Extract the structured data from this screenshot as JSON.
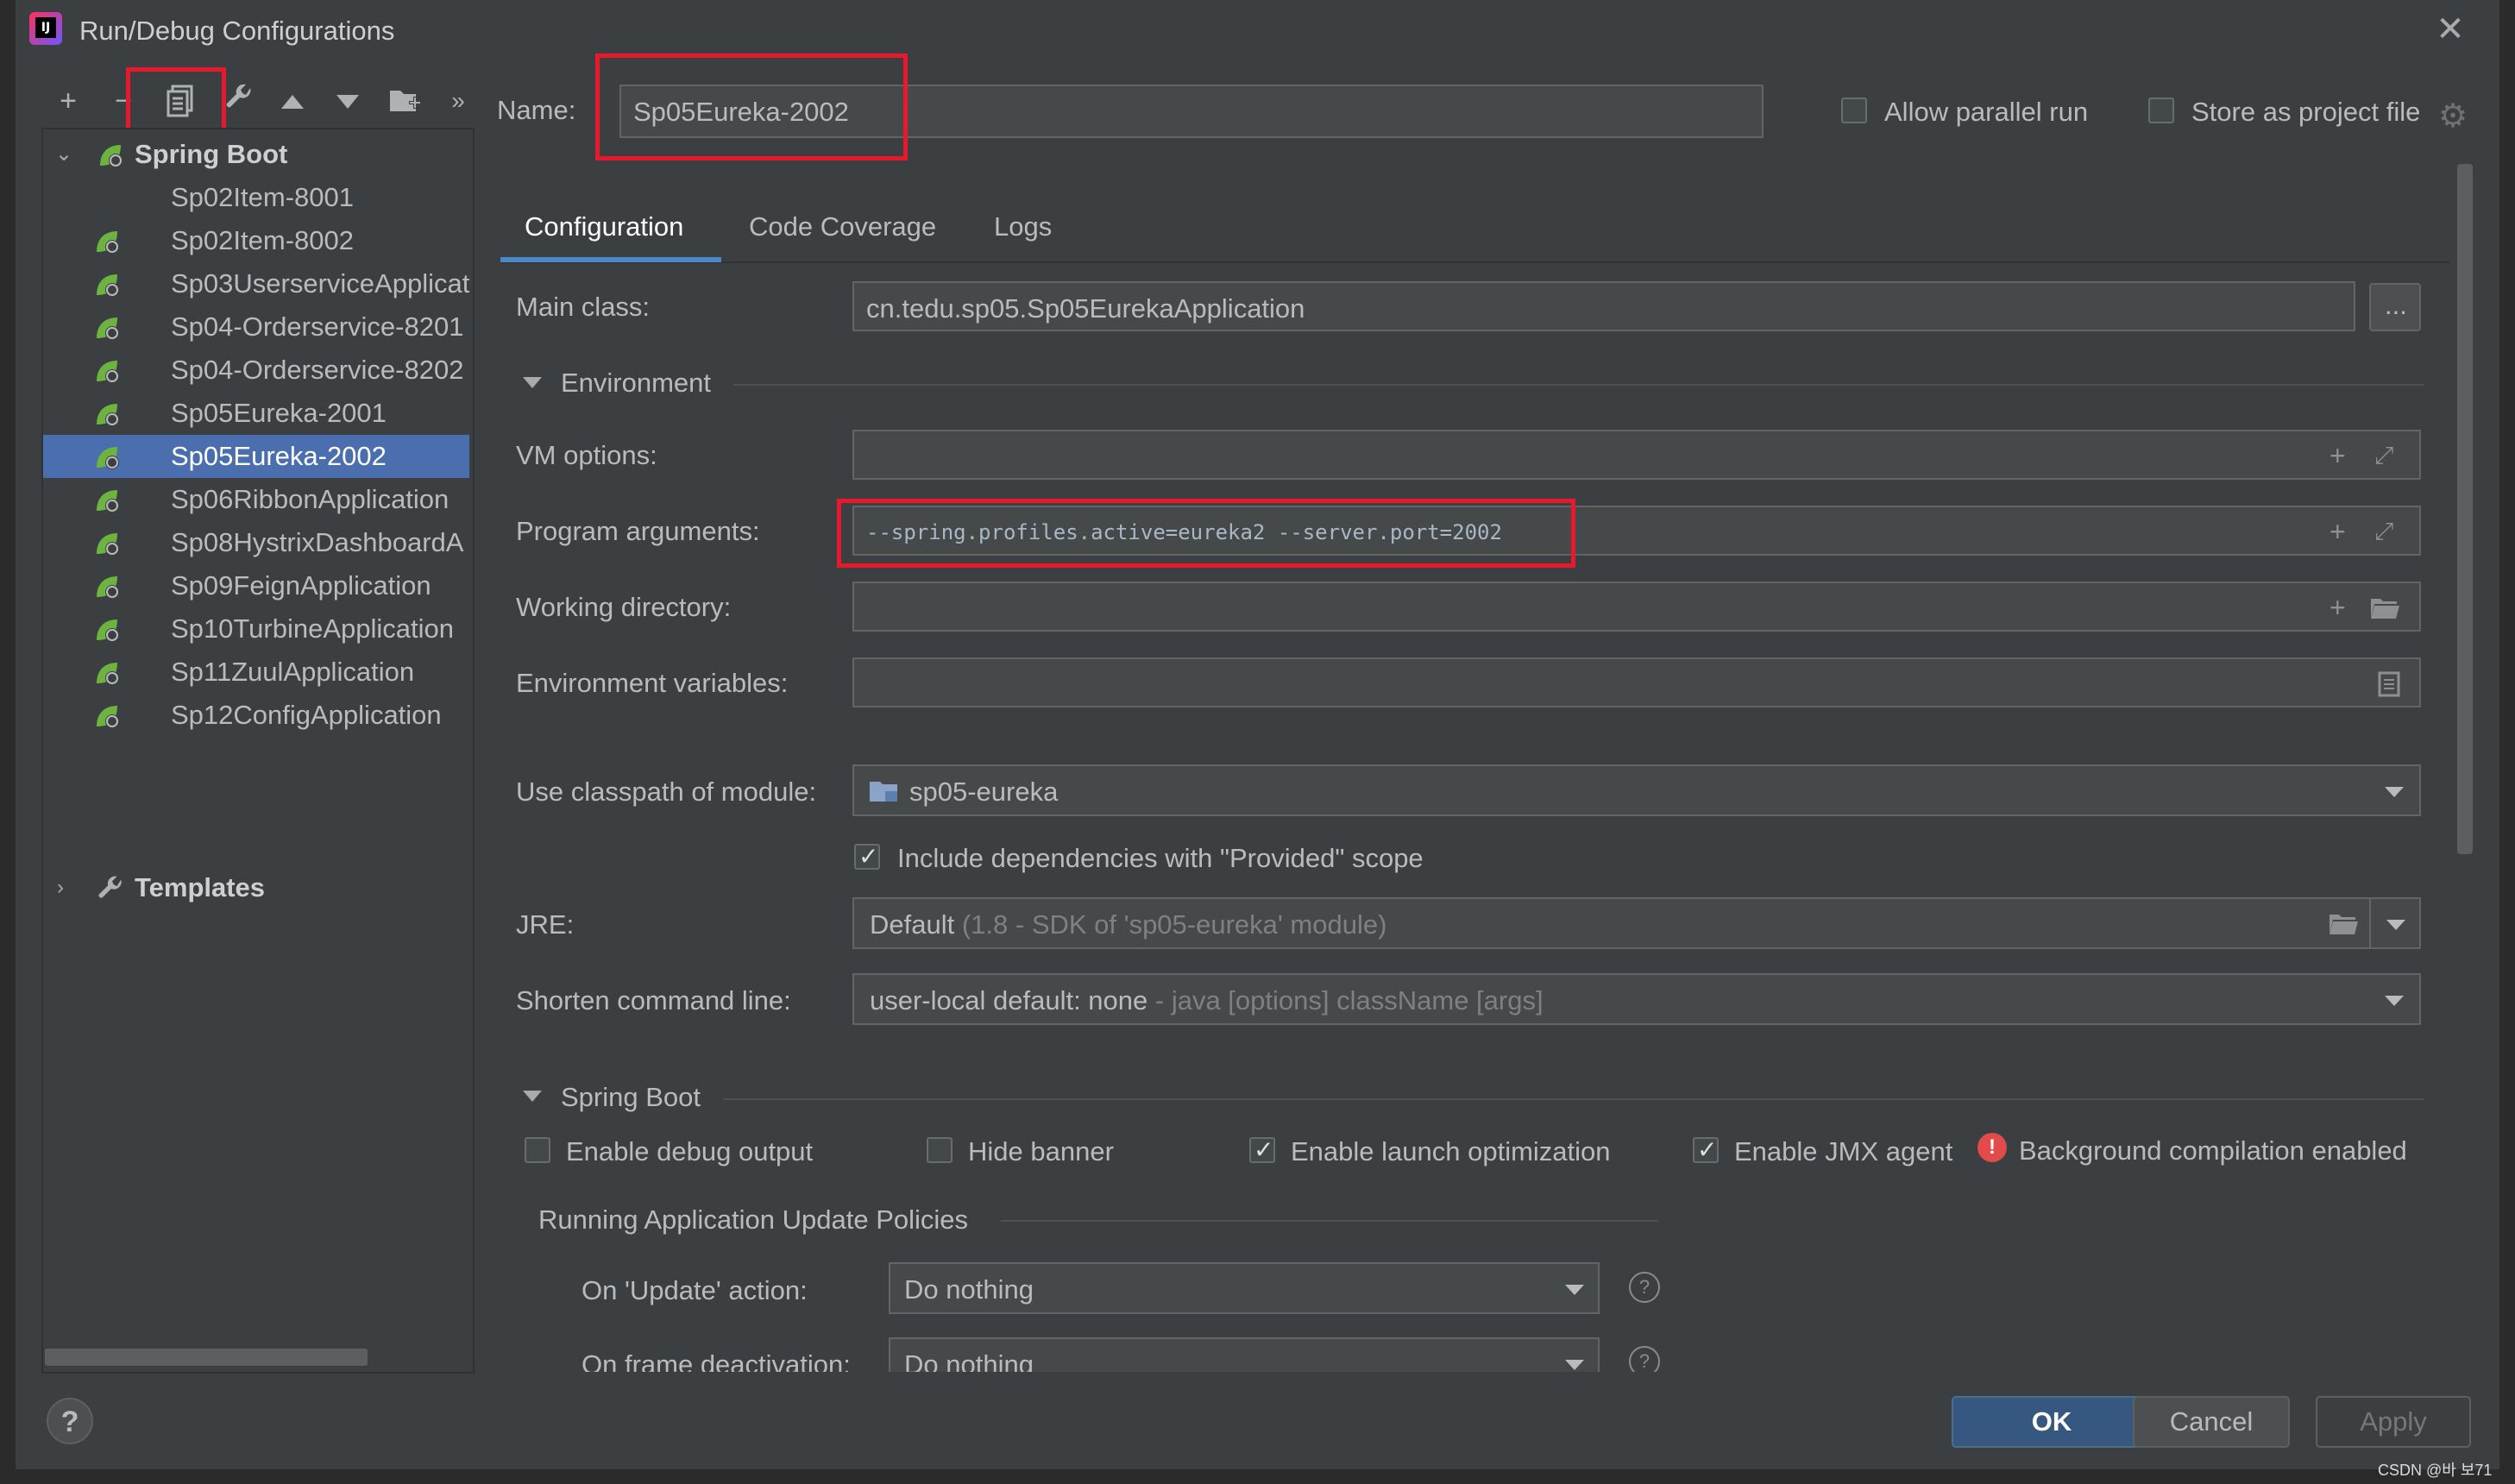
{
  "window": {
    "title": "Run/Debug Configurations"
  },
  "toolbar": {
    "add": "+",
    "remove": "−",
    "more": "»"
  },
  "tree": {
    "root_label": "Spring Boot",
    "items": [
      {
        "label": "Sp02Item-8001",
        "icon": false
      },
      {
        "label": "Sp02Item-8002",
        "icon": true
      },
      {
        "label": "Sp03UserserviceApplicat",
        "icon": true
      },
      {
        "label": "Sp04-Orderservice-8201",
        "icon": true
      },
      {
        "label": "Sp04-Orderservice-8202",
        "icon": true
      },
      {
        "label": "Sp05Eureka-2001",
        "icon": true
      },
      {
        "label": "Sp05Eureka-2002",
        "icon": true,
        "selected": true
      },
      {
        "label": "Sp06RibbonApplication",
        "icon": true
      },
      {
        "label": "Sp08HystrixDashboardA",
        "icon": true
      },
      {
        "label": "Sp09FeignApplication",
        "icon": true
      },
      {
        "label": "Sp10TurbineApplication",
        "icon": true
      },
      {
        "label": "Sp11ZuulApplication",
        "icon": true
      },
      {
        "label": "Sp12ConfigApplication",
        "icon": true
      }
    ],
    "templates_label": "Templates"
  },
  "header": {
    "name_label": "Name:",
    "name_value": "Sp05Eureka-2002",
    "allow_parallel_label": "Allow parallel run",
    "allow_parallel_checked": false,
    "store_project_label": "Store as project file",
    "store_project_checked": false
  },
  "tabs": [
    {
      "label": "Configuration",
      "active": true
    },
    {
      "label": "Code Coverage",
      "active": false
    },
    {
      "label": "Logs",
      "active": false
    }
  ],
  "config": {
    "main_class_label": "Main class:",
    "main_class_value": "cn.tedu.sp05.Sp05EurekaApplication",
    "browse_label": "...",
    "environment_label": "Environment",
    "vm_options_label": "VM options:",
    "vm_options_value": "",
    "program_args_label": "Program arguments:",
    "program_args_value": "--spring.profiles.active=eureka2 --server.port=2002",
    "working_dir_label": "Working directory:",
    "working_dir_value": "",
    "env_vars_label": "Environment variables:",
    "env_vars_value": "",
    "classpath_label": "Use classpath of module:",
    "classpath_value": "sp05-eureka",
    "include_deps_label": "Include dependencies with \"Provided\" scope",
    "include_deps_checked": true,
    "jre_label": "JRE:",
    "jre_value": "Default",
    "jre_hint": "(1.8 - SDK of 'sp05-eureka' module)",
    "shorten_label": "Shorten command line:",
    "shorten_value": "user-local default: none",
    "shorten_hint": "- java [options] className [args]"
  },
  "spring_boot": {
    "section_label": "Spring Boot",
    "enable_debug_label": "Enable debug output",
    "enable_debug_checked": false,
    "hide_banner_label": "Hide banner",
    "hide_banner_checked": false,
    "launch_opt_label": "Enable launch optimization",
    "launch_opt_checked": true,
    "jmx_label": "Enable JMX agent",
    "jmx_checked": true,
    "bg_compile_label": "Background compilation enabled",
    "update_policies_label": "Running Application Update Policies",
    "on_update_label": "On 'Update' action:",
    "on_update_value": "Do nothing",
    "on_frame_label": "On frame deactivation:",
    "on_frame_value": "Do nothing"
  },
  "footer": {
    "help": "?",
    "ok": "OK",
    "cancel": "Cancel",
    "apply": "Apply"
  },
  "watermark": "CSDN @바 보71",
  "colors": {
    "background": "#3c3f41",
    "selection": "#4b6eaf",
    "accent": "#4a88c7",
    "highlight_box": "#e8192c",
    "spring_green": "#6db33f",
    "warning": "#e34b4b"
  }
}
